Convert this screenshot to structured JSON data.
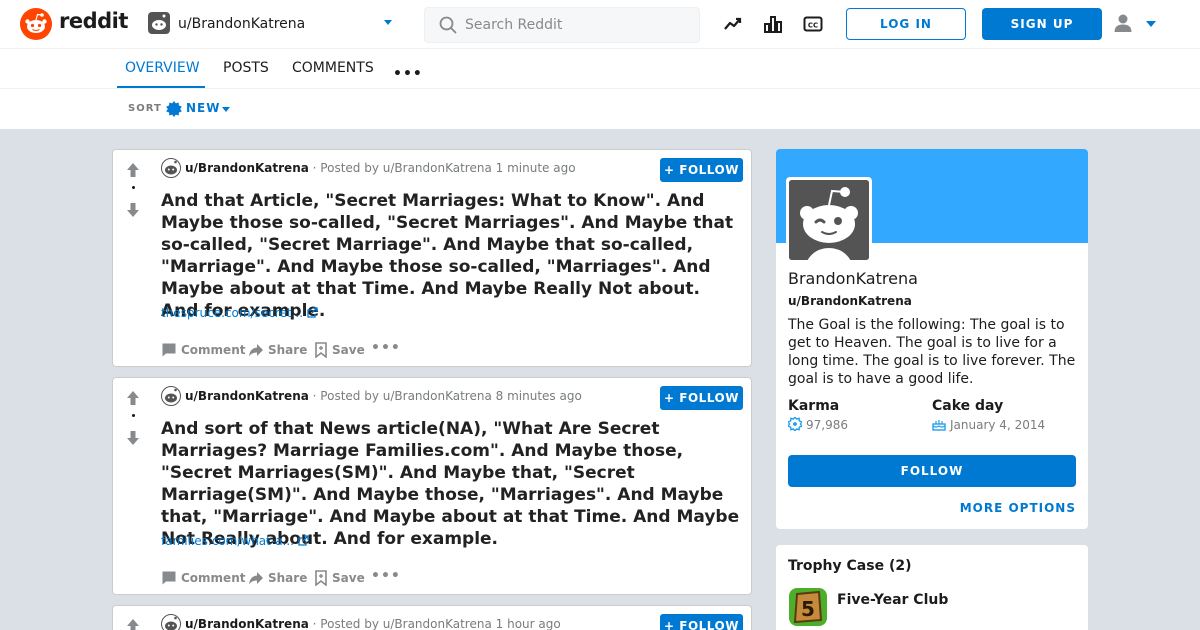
{
  "app": {
    "logo_text": "reddit"
  },
  "header": {
    "user_dropdown_name": "u/BrandonKatrena",
    "search_placeholder": "Search Reddit",
    "login_label": "LOG IN",
    "signup_label": "SIGN UP"
  },
  "tabs": [
    {
      "label": "OVERVIEW",
      "active": true
    },
    {
      "label": "POSTS",
      "active": false
    },
    {
      "label": "COMMENTS",
      "active": false
    }
  ],
  "tab_more": "•••",
  "sort": {
    "label": "SORT",
    "value": "NEW"
  },
  "posts": [
    {
      "author": "u/BrandonKatrena",
      "meta": "· Posted by u/BrandonKatrena 1 minute ago",
      "follow_label": "FOLLOW",
      "title": "And that Article, \"Secret Marriages: What to Know\". And Maybe those so-called, \"Secret Marriages\". And Maybe that so-called, \"Secret Marriage\". And Maybe that so-called, \"Marriage\". And Maybe those so-called, \"Marriages\". And Maybe about at that Time. And Maybe Really Not about. And for example.",
      "link": "thespruce.com/secret...",
      "actions": {
        "comment": "Comment",
        "share": "Share",
        "save": "Save",
        "more": "•••"
      }
    },
    {
      "author": "u/BrandonKatrena",
      "meta": "· Posted by u/BrandonKatrena 8 minutes ago",
      "follow_label": "FOLLOW",
      "title": "And sort of that News article(NA), \"What Are Secret Marriages? Marriage Families.com\". And Maybe those, \"Secret Marriages(SM)\". And Maybe that, \"Secret Marriage(SM)\". And Maybe those, \"Marriages\". And Maybe that, \"Marriage\". And Maybe about at that Time. And Maybe Not Really about. And for example.",
      "link": "families.com/what-a...",
      "actions": {
        "comment": "Comment",
        "share": "Share",
        "save": "Save",
        "more": "•••"
      }
    },
    {
      "author": "u/BrandonKatrena",
      "meta": "· Posted by u/BrandonKatrena 1 hour ago",
      "follow_label": "FOLLOW"
    }
  ],
  "profile": {
    "display_name": "BrandonKatrena",
    "handle": "u/BrandonKatrena",
    "about": "The Goal is the following: The goal is to get to Heaven. The goal is to live for a long time. The goal is to live forever. The goal is to have a good life.",
    "karma_label": "Karma",
    "karma_value": "97,986",
    "cake_label": "Cake day",
    "cake_value": "January 4, 2014",
    "follow_label": "FOLLOW",
    "more_options_label": "MORE OPTIONS"
  },
  "trophies": {
    "title": "Trophy Case (2)",
    "items": [
      {
        "name": "Five-Year Club",
        "icon": "five-year-club-icon"
      }
    ]
  },
  "colors": {
    "accent": "#0079d3",
    "brand": "#ff4500",
    "banner": "#33a8ff",
    "background": "#dae0e6"
  }
}
